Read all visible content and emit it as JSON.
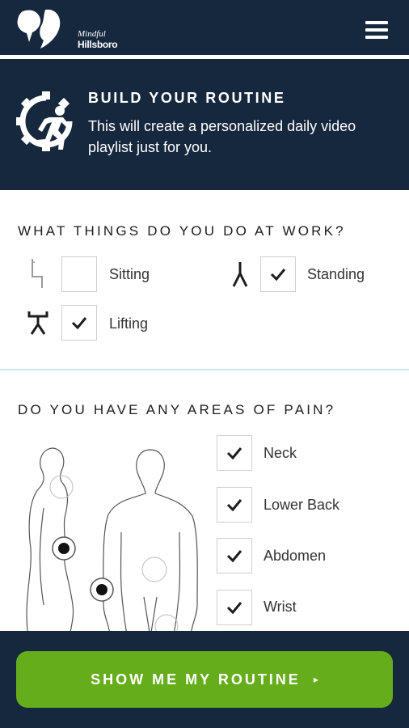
{
  "header": {
    "logo_line1": "Mindful",
    "logo_line2": "Hillsboro",
    "menu_icon": "hamburger-menu-icon"
  },
  "hero": {
    "icon": "gear-runner-icon",
    "title": "BUILD YOUR ROUTINE",
    "subtitle": "This will create a personalized daily video playlist just for you."
  },
  "work": {
    "question": "WHAT THINGS DO YOU DO AT WORK?",
    "options": [
      {
        "label": "Sitting",
        "checked": false,
        "icon": "sitting-figure-icon"
      },
      {
        "label": "Standing",
        "checked": true,
        "icon": "standing-figure-icon"
      },
      {
        "label": "Lifting",
        "checked": true,
        "icon": "lifting-figure-icon"
      }
    ]
  },
  "pain": {
    "question": "DO YOU HAVE ANY AREAS OF PAIN?",
    "options": [
      {
        "label": "Neck",
        "checked": true
      },
      {
        "label": "Lower Back",
        "checked": true
      },
      {
        "label": "Abdomen",
        "checked": true
      },
      {
        "label": "Wrist",
        "checked": true
      }
    ]
  },
  "cta": {
    "label": "SHOW ME MY ROUTINE",
    "arrow": "▸"
  },
  "colors": {
    "navy": "#16283e",
    "green": "#66ad1c",
    "divider": "#cfe4ee"
  }
}
